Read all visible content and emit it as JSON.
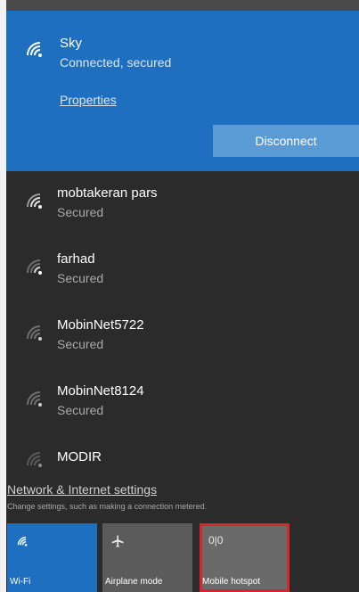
{
  "connected": {
    "name": "Sky",
    "status": "Connected, secured",
    "properties_label": "Properties",
    "disconnect_label": "Disconnect"
  },
  "networks": [
    {
      "name": "mobtakeran pars",
      "status": "Secured"
    },
    {
      "name": "farhad",
      "status": "Secured"
    },
    {
      "name": "MobinNet5722",
      "status": "Secured"
    },
    {
      "name": "MobinNet8124",
      "status": "Secured"
    },
    {
      "name": "MODIR",
      "status": ""
    }
  ],
  "settings": {
    "link": "Network & Internet settings",
    "description": "Change settings, such as making a connection metered."
  },
  "tiles": {
    "wifi": {
      "label": "Wi-Fi",
      "icon": "wifi-icon"
    },
    "airplane": {
      "label": "Airplane mode",
      "icon": "airplane-icon"
    },
    "hotspot": {
      "label": "Mobile hotspot",
      "icon": "hotspot-icon",
      "glyph": "0|0"
    }
  },
  "colors": {
    "accent": "#1e6fbf",
    "flyout_bg": "#2b2b2b",
    "highlight_border": "#d9262c"
  }
}
